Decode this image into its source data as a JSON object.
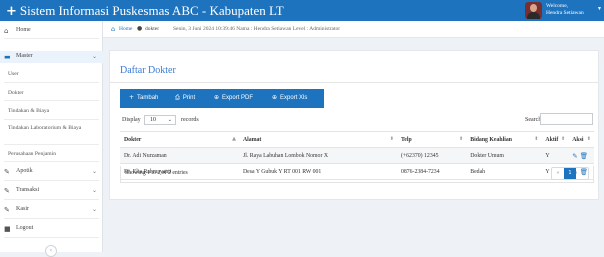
{
  "app": {
    "title": "Sistem Informasi Puskesmas ABC - Kabupaten LT",
    "plus_icon": "+",
    "welcome": "Welcome,",
    "user_name": "Hendra Setiawan"
  },
  "sidebar": {
    "items": [
      {
        "label": "Home",
        "icon": "home-icon",
        "glyph": "⌂"
      },
      {
        "label": "Master",
        "icon": "monitor-icon",
        "glyph": "▬",
        "expanded": true
      },
      {
        "label": "Apotik",
        "icon": "edit-icon",
        "glyph": "✎"
      },
      {
        "label": "Transaksi",
        "icon": "edit-icon",
        "glyph": "✎"
      },
      {
        "label": "Kasir",
        "icon": "edit-icon",
        "glyph": "✎"
      },
      {
        "label": "Logout",
        "icon": "lock-icon",
        "glyph": "■"
      }
    ],
    "submenu": [
      "User",
      "Dokter",
      "Tindakan & Biaya",
      "Tindakan Laboratorium & Biaya",
      "Perusahaan Penjamin"
    ],
    "chevron": "⌄",
    "collapse_glyph": "‹"
  },
  "breadcrumb": {
    "home": "Home",
    "current": "dokter",
    "info": "Senin, 3 Juni 2024 10:39:46 Nama : Hendra Setiawan Level : Administrator"
  },
  "panel": {
    "title": "Daftar Dokter",
    "buttons": [
      {
        "label": "Tambah",
        "glyph": "+"
      },
      {
        "label": "Print",
        "glyph": "⎙"
      },
      {
        "label": "Export PDF",
        "glyph": "⊕"
      },
      {
        "label": "Export Xls",
        "glyph": "⊕"
      }
    ],
    "display_label": "Display",
    "display_value": "10",
    "records_label": "records",
    "search_label": "Search:"
  },
  "table": {
    "columns": [
      "Dokter",
      "Alamat",
      "Telp",
      "Bidang Keahlian",
      "Aktif",
      "Aksi"
    ],
    "rows": [
      [
        "Dr. Adi Nurzaman",
        "Jl. Raya Labuhan Lombok Nomor X",
        "(+62370) 12345",
        "Dokter Umum",
        "Y"
      ],
      [
        "Dr. Elia Rahmayanti",
        "Desa Y Gubuk Y RT 001 RW 001",
        "0876-2384-7234",
        "Bedah",
        "Y"
      ]
    ],
    "footer": "Showing 1 to 2 of 2 entries",
    "pager": {
      "prev": "«",
      "current": "1",
      "next": "»"
    }
  },
  "colors": {
    "brand": "#1e73be",
    "title_accent": "#3a7bd5"
  }
}
